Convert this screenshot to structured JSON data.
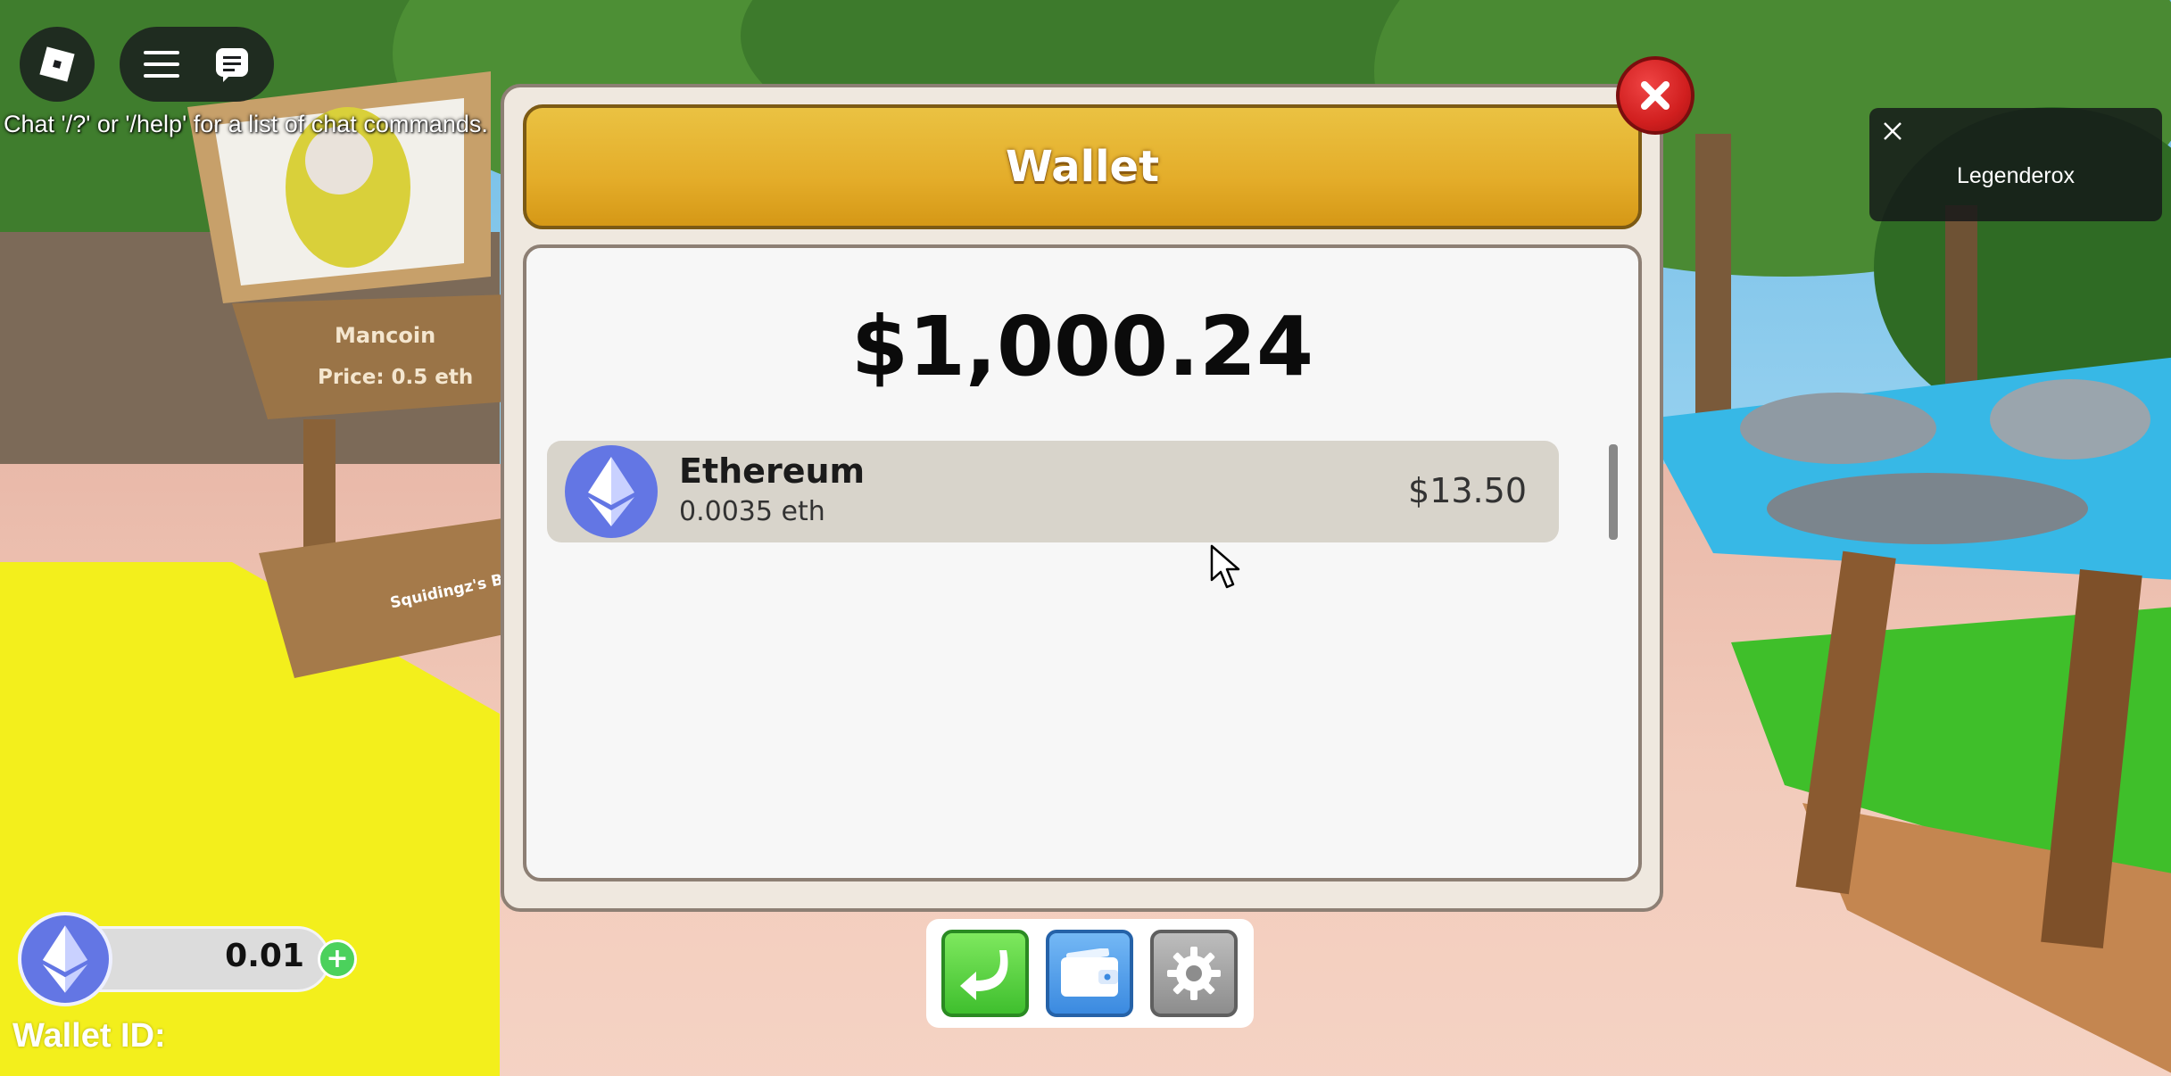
{
  "hud": {
    "roblox_icon": "roblox-logo-icon",
    "menu_icon": "hamburger-menu-icon",
    "chat_icon": "chat-icon",
    "chat_hint": "Chat '/?' or '/help' for a list of chat commands."
  },
  "world": {
    "sign_title": "Mancoin",
    "sign_price": "Price: 0.5 eth",
    "stand_label": "Squidingz's Bo"
  },
  "player_card": {
    "close_icon": "close-icon",
    "name": "Legenderox"
  },
  "wallet": {
    "title": "Wallet",
    "total_balance": "$1,000.24",
    "coins": [
      {
        "name": "Ethereum",
        "amount": "0.0035 eth",
        "value": "$13.50",
        "icon": "ethereum-icon"
      }
    ]
  },
  "toolbar": {
    "back_icon": "back-arrow-icon",
    "wallet_icon": "wallet-icon",
    "settings_icon": "gear-icon"
  },
  "eth_balance": {
    "value": "0.01",
    "add_label": "+"
  },
  "wallet_id": {
    "label": "Wallet ID:"
  },
  "colors": {
    "header_gold": "#e4ad2a",
    "close_red": "#d11f1f",
    "ethereum_blue": "#6376e4",
    "modal_bg": "#efe8df",
    "coin_row_bg": "#d8d4cb"
  }
}
